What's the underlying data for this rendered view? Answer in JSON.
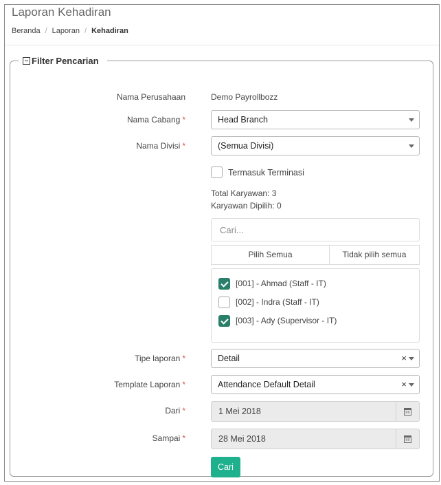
{
  "page": {
    "title": "Laporan Kehadiran",
    "breadcrumb": {
      "home": "Beranda",
      "section": "Laporan",
      "current": "Kehadiran"
    }
  },
  "filter": {
    "legend": "Filter Pencarian",
    "company": {
      "label": "Nama Perusahaan",
      "value": "Demo Payrollbozz"
    },
    "branch": {
      "label": "Nama Cabang",
      "value": "Head Branch"
    },
    "division": {
      "label": "Nama Divisi",
      "value": "(Semua Divisi)"
    },
    "include_termination": {
      "label": "Termasuk Terminasi",
      "checked": false
    },
    "summary": {
      "total": "Total Karyawan: 3",
      "selected": "Karyawan Dipilih: 0"
    },
    "search": {
      "placeholder": "Cari..."
    },
    "select_all_label": "Pilih Semua",
    "deselect_all_label": "Tidak pilih semua",
    "employees": [
      {
        "label": "[001] - Ahmad (Staff - IT)",
        "checked": true
      },
      {
        "label": "[002] - Indra (Staff - IT)",
        "checked": false
      },
      {
        "label": "[003] - Ady (Supervisor - IT)",
        "checked": true
      }
    ],
    "report_type": {
      "label": "Tipe laporan",
      "value": "Detail"
    },
    "template": {
      "label": "Template Laporan",
      "value": "Attendance Default Detail"
    },
    "date_from": {
      "label": "Dari",
      "value": "1 Mei 2018"
    },
    "date_to": {
      "label": "Sampai",
      "value": "28 Mei 2018"
    },
    "required_marker": "*",
    "clear_symbol": "×",
    "submit_label": "Cari"
  },
  "colors": {
    "accent": "#1fb08e",
    "checkbox": "#2a7f6a",
    "required": "#d9534f"
  }
}
